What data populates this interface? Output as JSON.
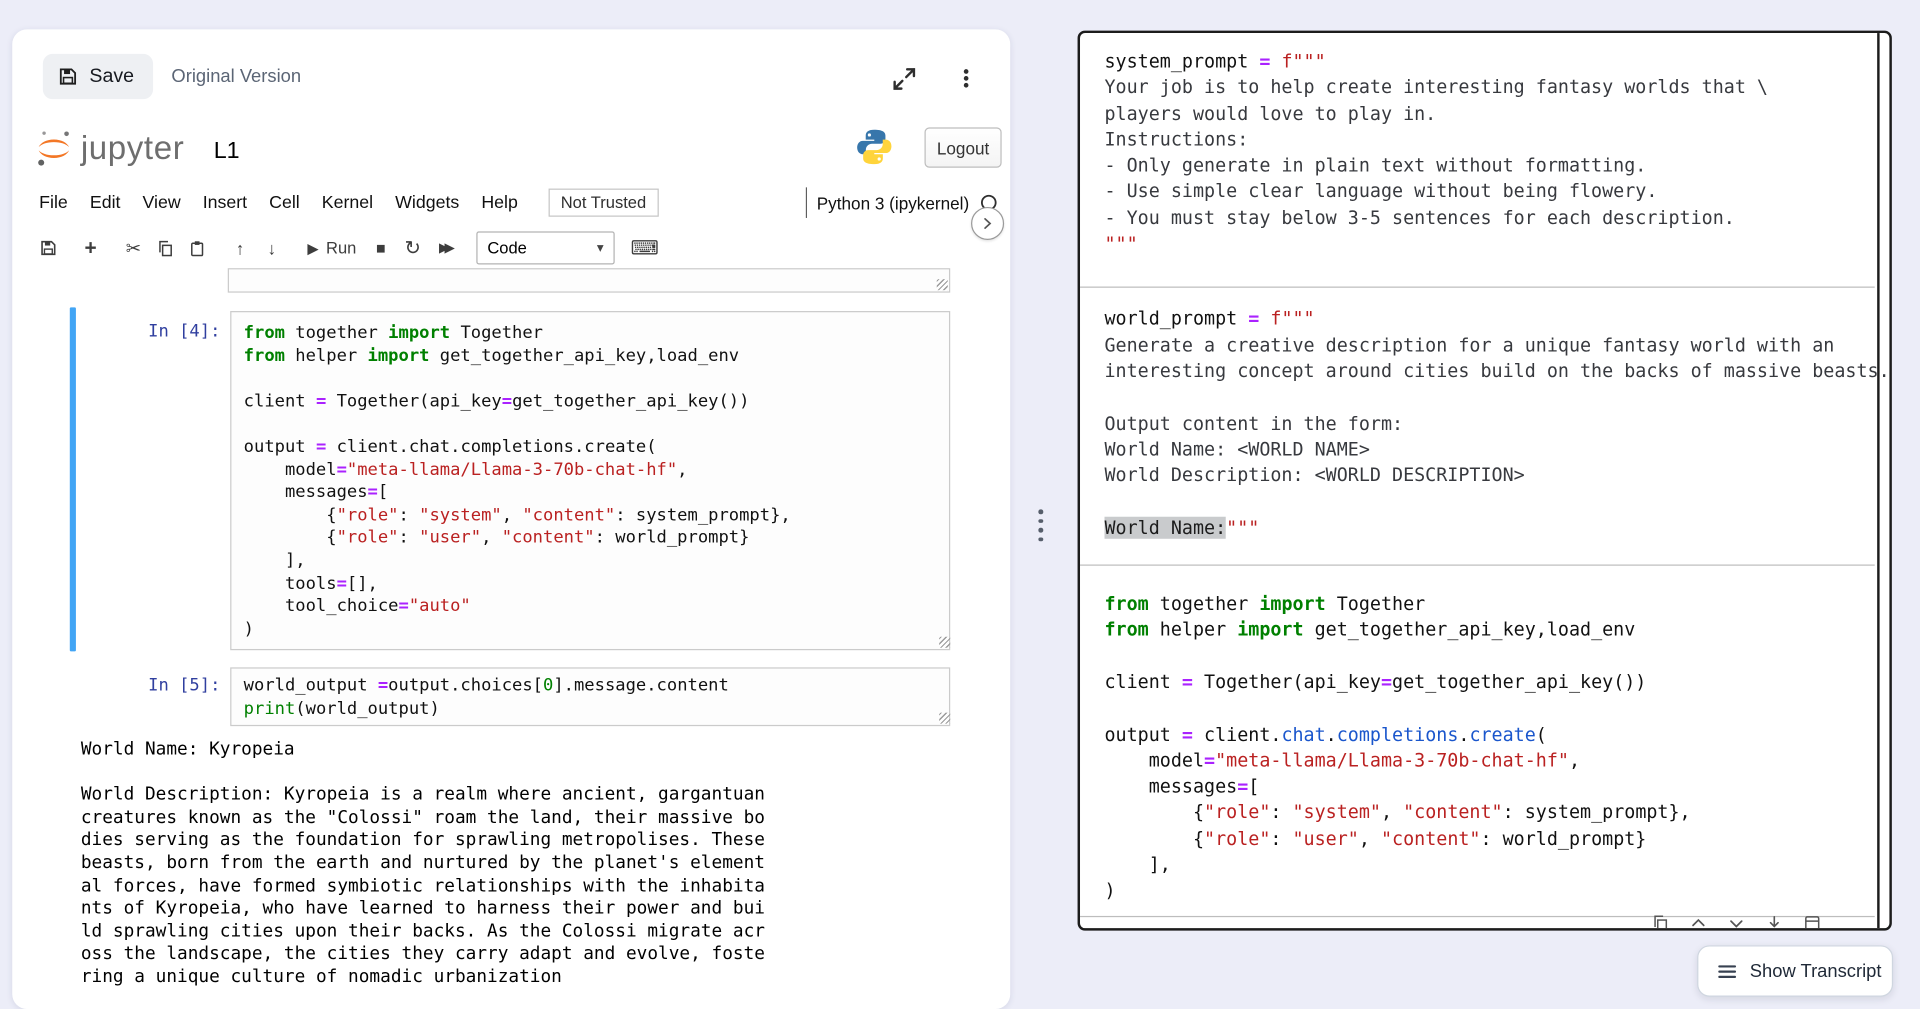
{
  "colors": {
    "page_bg": "#ecedf8",
    "jupyter_orange": "#F37726",
    "prompt_blue": "#303F9F",
    "keyword_green": "#008000",
    "string_red": "#BA2121",
    "operator_purple": "#AA22FF",
    "selected_cell_blue": "#42A5F5"
  },
  "icons": {
    "plus": "+",
    "cut": "✂",
    "arrow_up": "↑",
    "arrow_down": "↓",
    "run": "▶",
    "stop": "■",
    "restart": "↻",
    "fast_forward": "▶▶",
    "dropdown": "▾",
    "keyboard": "⌨"
  },
  "notebook": {
    "save_label": "Save",
    "original_version_label": "Original Version",
    "logo_text": "jupyter",
    "notebook_title": "L1",
    "logout_label": "Logout",
    "menu_items": [
      "File",
      "Edit",
      "View",
      "Insert",
      "Cell",
      "Kernel",
      "Widgets",
      "Help"
    ],
    "trust_badge": "Not Trusted",
    "kernel_name": "Python 3 (ipykernel)",
    "toolbar": {
      "run_label": "Run",
      "cell_type": "Code"
    },
    "cells": {
      "in4_prompt": "In [4]:",
      "in4_code": [
        [
          [
            "k",
            "from"
          ],
          [
            "p",
            " together "
          ],
          [
            "k",
            "import"
          ],
          [
            "p",
            " Together"
          ]
        ],
        [
          [
            "k",
            "from"
          ],
          [
            "p",
            " helper "
          ],
          [
            "k",
            "import"
          ],
          [
            "p",
            " get_together_api_key,load_env"
          ]
        ],
        [],
        [
          [
            "p",
            "client "
          ],
          [
            "o",
            "="
          ],
          [
            "p",
            " Together(api_key"
          ],
          [
            "o",
            "="
          ],
          [
            "p",
            "get_together_api_key())"
          ]
        ],
        [],
        [
          [
            "p",
            "output "
          ],
          [
            "o",
            "="
          ],
          [
            "p",
            " client.chat.completions.create("
          ]
        ],
        [
          [
            "p",
            "    model"
          ],
          [
            "o",
            "="
          ],
          [
            "s",
            "\"meta-llama/Llama-3-70b-chat-hf\""
          ],
          [
            "p",
            ","
          ]
        ],
        [
          [
            "p",
            "    messages"
          ],
          [
            "o",
            "="
          ],
          [
            "p",
            "["
          ]
        ],
        [
          [
            "p",
            "        {"
          ],
          [
            "s",
            "\"role\""
          ],
          [
            "p",
            ": "
          ],
          [
            "s",
            "\"system\""
          ],
          [
            "p",
            ", "
          ],
          [
            "s",
            "\"content\""
          ],
          [
            "p",
            ": system_prompt},"
          ]
        ],
        [
          [
            "p",
            "        {"
          ],
          [
            "s",
            "\"role\""
          ],
          [
            "p",
            ": "
          ],
          [
            "s",
            "\"user\""
          ],
          [
            "p",
            ", "
          ],
          [
            "s",
            "\"content\""
          ],
          [
            "p",
            ": world_prompt}"
          ]
        ],
        [
          [
            "p",
            "    ],"
          ]
        ],
        [
          [
            "p",
            "    tools"
          ],
          [
            "o",
            "="
          ],
          [
            "p",
            "[],"
          ]
        ],
        [
          [
            "p",
            "    tool_choice"
          ],
          [
            "o",
            "="
          ],
          [
            "s",
            "\"auto\""
          ]
        ],
        [
          [
            "p",
            ")"
          ]
        ]
      ],
      "in5_prompt": "In [5]:",
      "in5_code": [
        [
          [
            "p",
            "world_output "
          ],
          [
            "o",
            "="
          ],
          [
            "p",
            "output.choices["
          ],
          [
            "n",
            "0"
          ],
          [
            "p",
            "].message.content"
          ]
        ],
        [
          [
            "b",
            "print"
          ],
          [
            "p",
            "(world_output)"
          ]
        ]
      ],
      "output_text": "World Name: Kyropeia\n\nWorld Description: Kyropeia is a realm where ancient, gargantuan\ncreatures known as the \"Colossi\" roam the land, their massive bo\ndies serving as the foundation for sprawling metropolises. These\nbeasts, born from the earth and nurtured by the planet's element\nal forces, have formed symbiotic relationships with the inhabita\nnts of Kyropeia, who have learned to harness their power and bui\nld sprawling cities upon their backs. As the Colossi migrate acr\noss the landscape, the cities they carry adapt and evolve, foste\nring a unique culture of nomadic urbanization"
    }
  },
  "code_panel": {
    "block1": [
      [
        [
          "p",
          "system_prompt "
        ],
        [
          "o",
          "="
        ],
        [
          "p",
          " "
        ],
        [
          "s",
          "f\"\"\""
        ]
      ],
      [
        [
          "d",
          "Your job is to help create interesting fantasy worlds that \\"
        ]
      ],
      [
        [
          "d",
          "players would love to play in."
        ]
      ],
      [
        [
          "d",
          "Instructions:"
        ]
      ],
      [
        [
          "d",
          "- Only generate in plain text without formatting."
        ]
      ],
      [
        [
          "d",
          "- Use simple clear language without being flowery."
        ]
      ],
      [
        [
          "d",
          "- You must stay below 3-5 sentences for each description."
        ]
      ],
      [
        [
          "s",
          "\"\"\""
        ]
      ]
    ],
    "block2": [
      [
        [
          "p",
          "world_prompt "
        ],
        [
          "o",
          "="
        ],
        [
          "p",
          " "
        ],
        [
          "s",
          "f\"\"\""
        ]
      ],
      [
        [
          "d",
          "Generate a creative description for a unique fantasy world with an"
        ]
      ],
      [
        [
          "d",
          "interesting concept around cities build on the backs of massive beasts."
        ]
      ],
      [],
      [
        [
          "d",
          "Output content in the form:"
        ]
      ],
      [
        [
          "d",
          "World Name: <WORLD NAME>"
        ]
      ],
      [
        [
          "d",
          "World Description: <WORLD DESCRIPTION>"
        ]
      ],
      [],
      [
        [
          "hl",
          "World Name:"
        ],
        [
          "s",
          "\"\"\""
        ]
      ]
    ],
    "block3": [
      [
        [
          "k",
          "from"
        ],
        [
          "p",
          " together "
        ],
        [
          "k",
          "import"
        ],
        [
          "p",
          " Together"
        ]
      ],
      [
        [
          "k",
          "from"
        ],
        [
          "p",
          " helper "
        ],
        [
          "k",
          "import"
        ],
        [
          "p",
          " get_together_api_key,load_env"
        ]
      ],
      [],
      [
        [
          "p",
          "client "
        ],
        [
          "o",
          "="
        ],
        [
          "p",
          " Together(api_key"
        ],
        [
          "o",
          "="
        ],
        [
          "p",
          "get_together_api_key())"
        ]
      ],
      [],
      [
        [
          "p",
          "output "
        ],
        [
          "o",
          "="
        ],
        [
          "p",
          " client."
        ],
        [
          "f",
          "chat"
        ],
        [
          "p",
          "."
        ],
        [
          "f",
          "completions"
        ],
        [
          "p",
          "."
        ],
        [
          "f",
          "create"
        ],
        [
          "p",
          "("
        ]
      ],
      [
        [
          "p",
          "    model"
        ],
        [
          "o",
          "="
        ],
        [
          "s",
          "\"meta-llama/Llama-3-70b-chat-hf\""
        ],
        [
          "p",
          ","
        ]
      ],
      [
        [
          "p",
          "    messages"
        ],
        [
          "o",
          "="
        ],
        [
          "p",
          "["
        ]
      ],
      [
        [
          "p",
          "        {"
        ],
        [
          "s",
          "\"role\""
        ],
        [
          "p",
          ": "
        ],
        [
          "s",
          "\"system\""
        ],
        [
          "p",
          ", "
        ],
        [
          "s",
          "\"content\""
        ],
        [
          "p",
          ": system_prompt},"
        ]
      ],
      [
        [
          "p",
          "        {"
        ],
        [
          "s",
          "\"role\""
        ],
        [
          "p",
          ": "
        ],
        [
          "s",
          "\"user\""
        ],
        [
          "p",
          ", "
        ],
        [
          "s",
          "\"content\""
        ],
        [
          "p",
          ": world_prompt}"
        ]
      ],
      [
        [
          "p",
          "    ],"
        ]
      ],
      [
        [
          "p",
          ")"
        ]
      ]
    ]
  },
  "transcript_button": {
    "label": "Show Transcript"
  }
}
